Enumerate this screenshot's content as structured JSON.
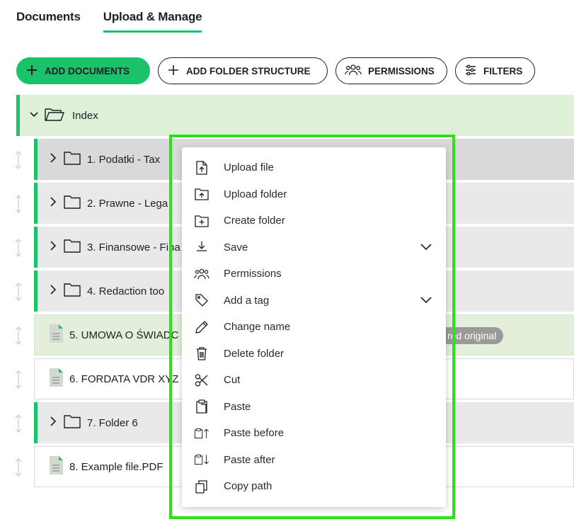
{
  "tabs": [
    {
      "label": "Documents",
      "active": false
    },
    {
      "label": "Upload & Manage",
      "active": true
    }
  ],
  "toolbar": {
    "add_documents": "ADD DOCUMENTS",
    "add_folder_structure": "ADD FOLDER STRUCTURE",
    "permissions": "PERMISSIONS",
    "filters": "FILTERS"
  },
  "tree": {
    "root": "Index",
    "items": [
      {
        "label": "1. Podatki - Tax",
        "type": "folder"
      },
      {
        "label": "2. Prawne - Lega",
        "type": "folder"
      },
      {
        "label": "3. Finansowe - Fina",
        "type": "folder"
      },
      {
        "label": "4. Redaction too",
        "type": "folder"
      },
      {
        "label": "5. UMOWA O ŚWIADC",
        "type": "file"
      },
      {
        "label": "6. FORDATA VDR XYZ",
        "type": "file"
      },
      {
        "label": "7. Folder 6",
        "type": "folder"
      },
      {
        "label": "8. Example file.PDF",
        "type": "file"
      }
    ],
    "badge": "red original"
  },
  "context_menu": {
    "items": [
      {
        "label": "Upload file",
        "icon": "upload-file-icon"
      },
      {
        "label": "Upload folder",
        "icon": "upload-folder-icon"
      },
      {
        "label": "Create folder",
        "icon": "create-folder-icon"
      },
      {
        "label": "Save",
        "icon": "download-icon",
        "submenu": true
      },
      {
        "label": "Permissions",
        "icon": "users-icon"
      },
      {
        "label": "Add a tag",
        "icon": "tag-icon",
        "submenu": true
      },
      {
        "label": "Change name",
        "icon": "pencil-icon"
      },
      {
        "label": "Delete folder",
        "icon": "trash-icon"
      },
      {
        "label": "Cut",
        "icon": "scissors-icon"
      },
      {
        "label": "Paste",
        "icon": "clipboard-icon"
      },
      {
        "label": "Paste before",
        "icon": "paste-before-icon"
      },
      {
        "label": "Paste after",
        "icon": "paste-after-icon"
      },
      {
        "label": "Copy path",
        "icon": "copy-icon"
      }
    ]
  },
  "colors": {
    "accent": "#19c26b",
    "highlight": "#2ee01a",
    "root_bg": "#dff0d8"
  }
}
